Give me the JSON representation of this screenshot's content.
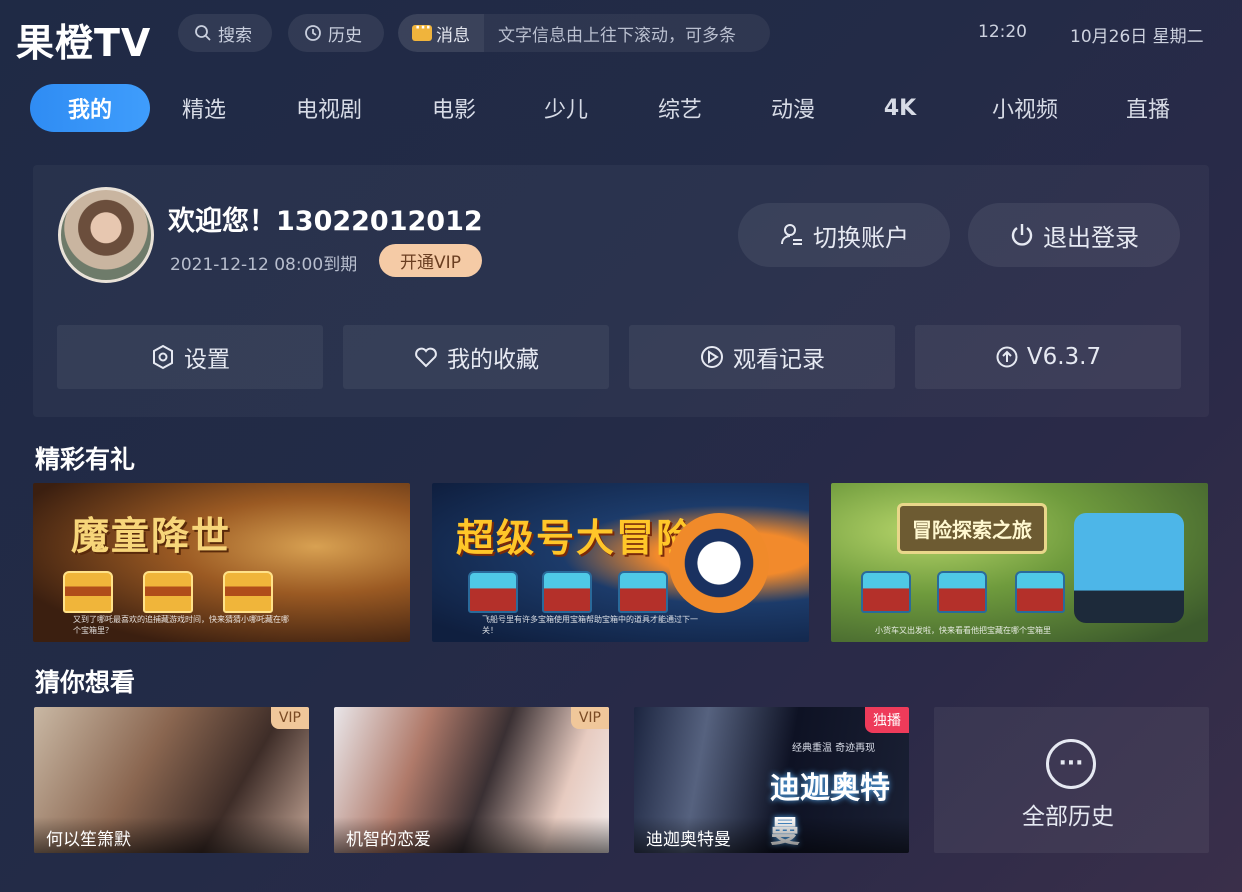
{
  "app": {
    "logo": "果橙TV"
  },
  "topbar": {
    "search_label": "搜索",
    "history_label": "历史",
    "message_label": "消息",
    "message_text": "文字信息由上往下滚动，可多条",
    "time": "12:20",
    "date": "10月26日 星期二"
  },
  "nav": {
    "items": [
      {
        "label": "我的",
        "active": true
      },
      {
        "label": "精选"
      },
      {
        "label": "电视剧"
      },
      {
        "label": "电影"
      },
      {
        "label": "少儿"
      },
      {
        "label": "综艺"
      },
      {
        "label": "动漫"
      },
      {
        "label": "4K"
      },
      {
        "label": "小视频"
      },
      {
        "label": "直播"
      }
    ]
  },
  "user": {
    "welcome": "欢迎您！13022012012",
    "expire": "2021-12-12  08:00到期",
    "vip_button": "开通VIP",
    "switch_account": "切换账户",
    "logout": "退出登录"
  },
  "actions": [
    {
      "label": "设置",
      "icon": "settings-icon"
    },
    {
      "label": "我的收藏",
      "icon": "heart-icon"
    },
    {
      "label": "观看记录",
      "icon": "play-circle-icon"
    },
    {
      "label": "V6.3.7",
      "icon": "upload-circle-icon"
    }
  ],
  "gifts": {
    "title": "精彩有礼",
    "banners": [
      {
        "title": "魔童降世",
        "note": "又到了哪吒最喜欢的追捕藏游戏时间，快来猜猜小哪吒藏在哪个宝箱里？"
      },
      {
        "title": "超级号大冒险",
        "note": "飞船号里有许多宝箱使用宝箱帮助宝箱中的道具才能通过下一关！"
      },
      {
        "title": "冒险探索之旅",
        "note": "小货车又出发啦，快来看看他把宝藏在哪个宝箱里"
      }
    ]
  },
  "recommend": {
    "title": "猜你想看",
    "cards": [
      {
        "caption": "何以笙箫默",
        "badge": "VIP"
      },
      {
        "caption": "机智的恋爱",
        "badge": "VIP"
      },
      {
        "caption": "迪迦奥特曼",
        "badge": "独播",
        "poster_title": "迪迦奥特曼",
        "poster_sub": "经典重温 奇迹再现"
      }
    ],
    "all_history": "全部历史"
  },
  "colors": {
    "accent": "#3f9dfc",
    "vip": "#f5cba6",
    "exclusive": "#ee3b5a"
  }
}
